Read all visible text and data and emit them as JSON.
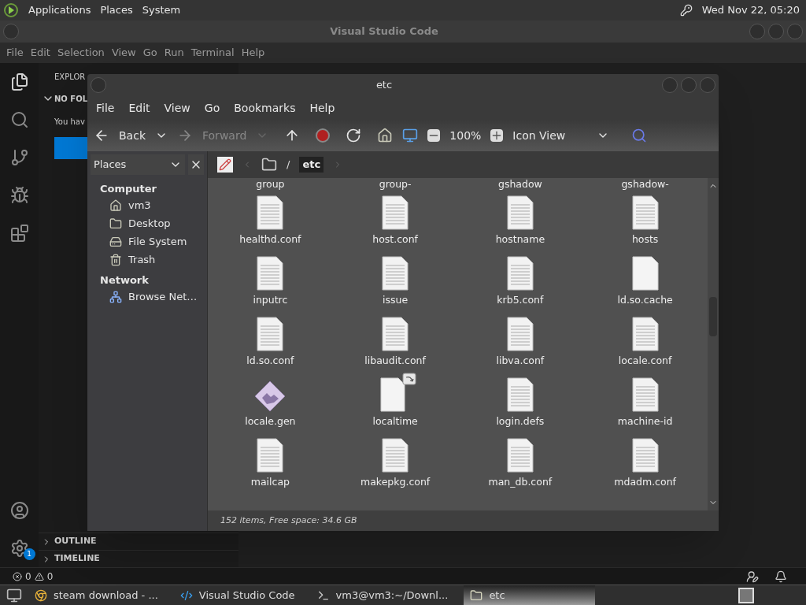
{
  "top_panel": {
    "menus": [
      "Applications",
      "Places",
      "System"
    ],
    "clock": "Wed Nov 22, 05:20"
  },
  "vscode": {
    "title": "Visual Studio Code",
    "menus": [
      "File",
      "Edit",
      "Selection",
      "View",
      "Go",
      "Run",
      "Terminal",
      "Help"
    ],
    "activity_badge": "1",
    "explorer": {
      "title": "EXPLOR",
      "section": "NO FOL",
      "message": "You hav"
    },
    "panels": [
      {
        "label": "OUTLINE",
        "expanded": false
      },
      {
        "label": "TIMELINE",
        "expanded": false
      }
    ],
    "status_bar": {
      "errors": "0",
      "warnings": "0"
    }
  },
  "file_manager": {
    "title": "etc",
    "menus": [
      "File",
      "Edit",
      "View",
      "Go",
      "Bookmarks",
      "Help"
    ],
    "toolbar": {
      "back": "Back",
      "forward": "Forward",
      "forward_disabled": true,
      "zoom": "100%",
      "view_mode": "Icon View"
    },
    "side_pane": {
      "selector": "Places",
      "sections": [
        {
          "heading": "Computer",
          "items": [
            {
              "label": "vm3",
              "kind": "home"
            },
            {
              "label": "Desktop",
              "kind": "desktop"
            },
            {
              "label": "File System",
              "kind": "drive"
            },
            {
              "label": "Trash",
              "kind": "trash"
            }
          ]
        },
        {
          "heading": "Network",
          "items": [
            {
              "label": "Browse Net…",
              "kind": "network"
            }
          ]
        }
      ]
    },
    "path_separator": "/",
    "path": [
      {
        "label": "etc",
        "selected": true
      }
    ],
    "files": [
      {
        "name": "group"
      },
      {
        "name": "group-"
      },
      {
        "name": "gshadow"
      },
      {
        "name": "gshadow-"
      },
      {
        "name": "healthd.conf",
        "kind": "text"
      },
      {
        "name": "host.conf",
        "kind": "text"
      },
      {
        "name": "hostname",
        "kind": "text"
      },
      {
        "name": "hosts",
        "kind": "text"
      },
      {
        "name": "inputrc",
        "kind": "text"
      },
      {
        "name": "issue",
        "kind": "text"
      },
      {
        "name": "krb5.conf",
        "kind": "text"
      },
      {
        "name": "ld.so.cache",
        "kind": "blank"
      },
      {
        "name": "ld.so.conf",
        "kind": "text"
      },
      {
        "name": "libaudit.conf",
        "kind": "text"
      },
      {
        "name": "libva.conf",
        "kind": "text"
      },
      {
        "name": "locale.conf",
        "kind": "text"
      },
      {
        "name": "locale.gen",
        "kind": "image"
      },
      {
        "name": "localtime",
        "kind": "link"
      },
      {
        "name": "login.defs",
        "kind": "text"
      },
      {
        "name": "machine-id",
        "kind": "text"
      },
      {
        "name": "mailcap",
        "kind": "text"
      },
      {
        "name": "makepkg.conf",
        "kind": "text"
      },
      {
        "name": "man_db.conf",
        "kind": "text"
      },
      {
        "name": "mdadm.conf",
        "kind": "text"
      }
    ],
    "status": "152 items, Free space: 34.6 GB"
  },
  "taskbar": [
    {
      "label": "steam download - ...",
      "kind": "browser",
      "selected": false
    },
    {
      "label": "Visual Studio Code",
      "kind": "code",
      "selected": false
    },
    {
      "label": "vm3@vm3:~/Downl...",
      "kind": "terminal",
      "selected": false
    },
    {
      "label": "etc",
      "kind": "folder",
      "selected": true
    }
  ]
}
